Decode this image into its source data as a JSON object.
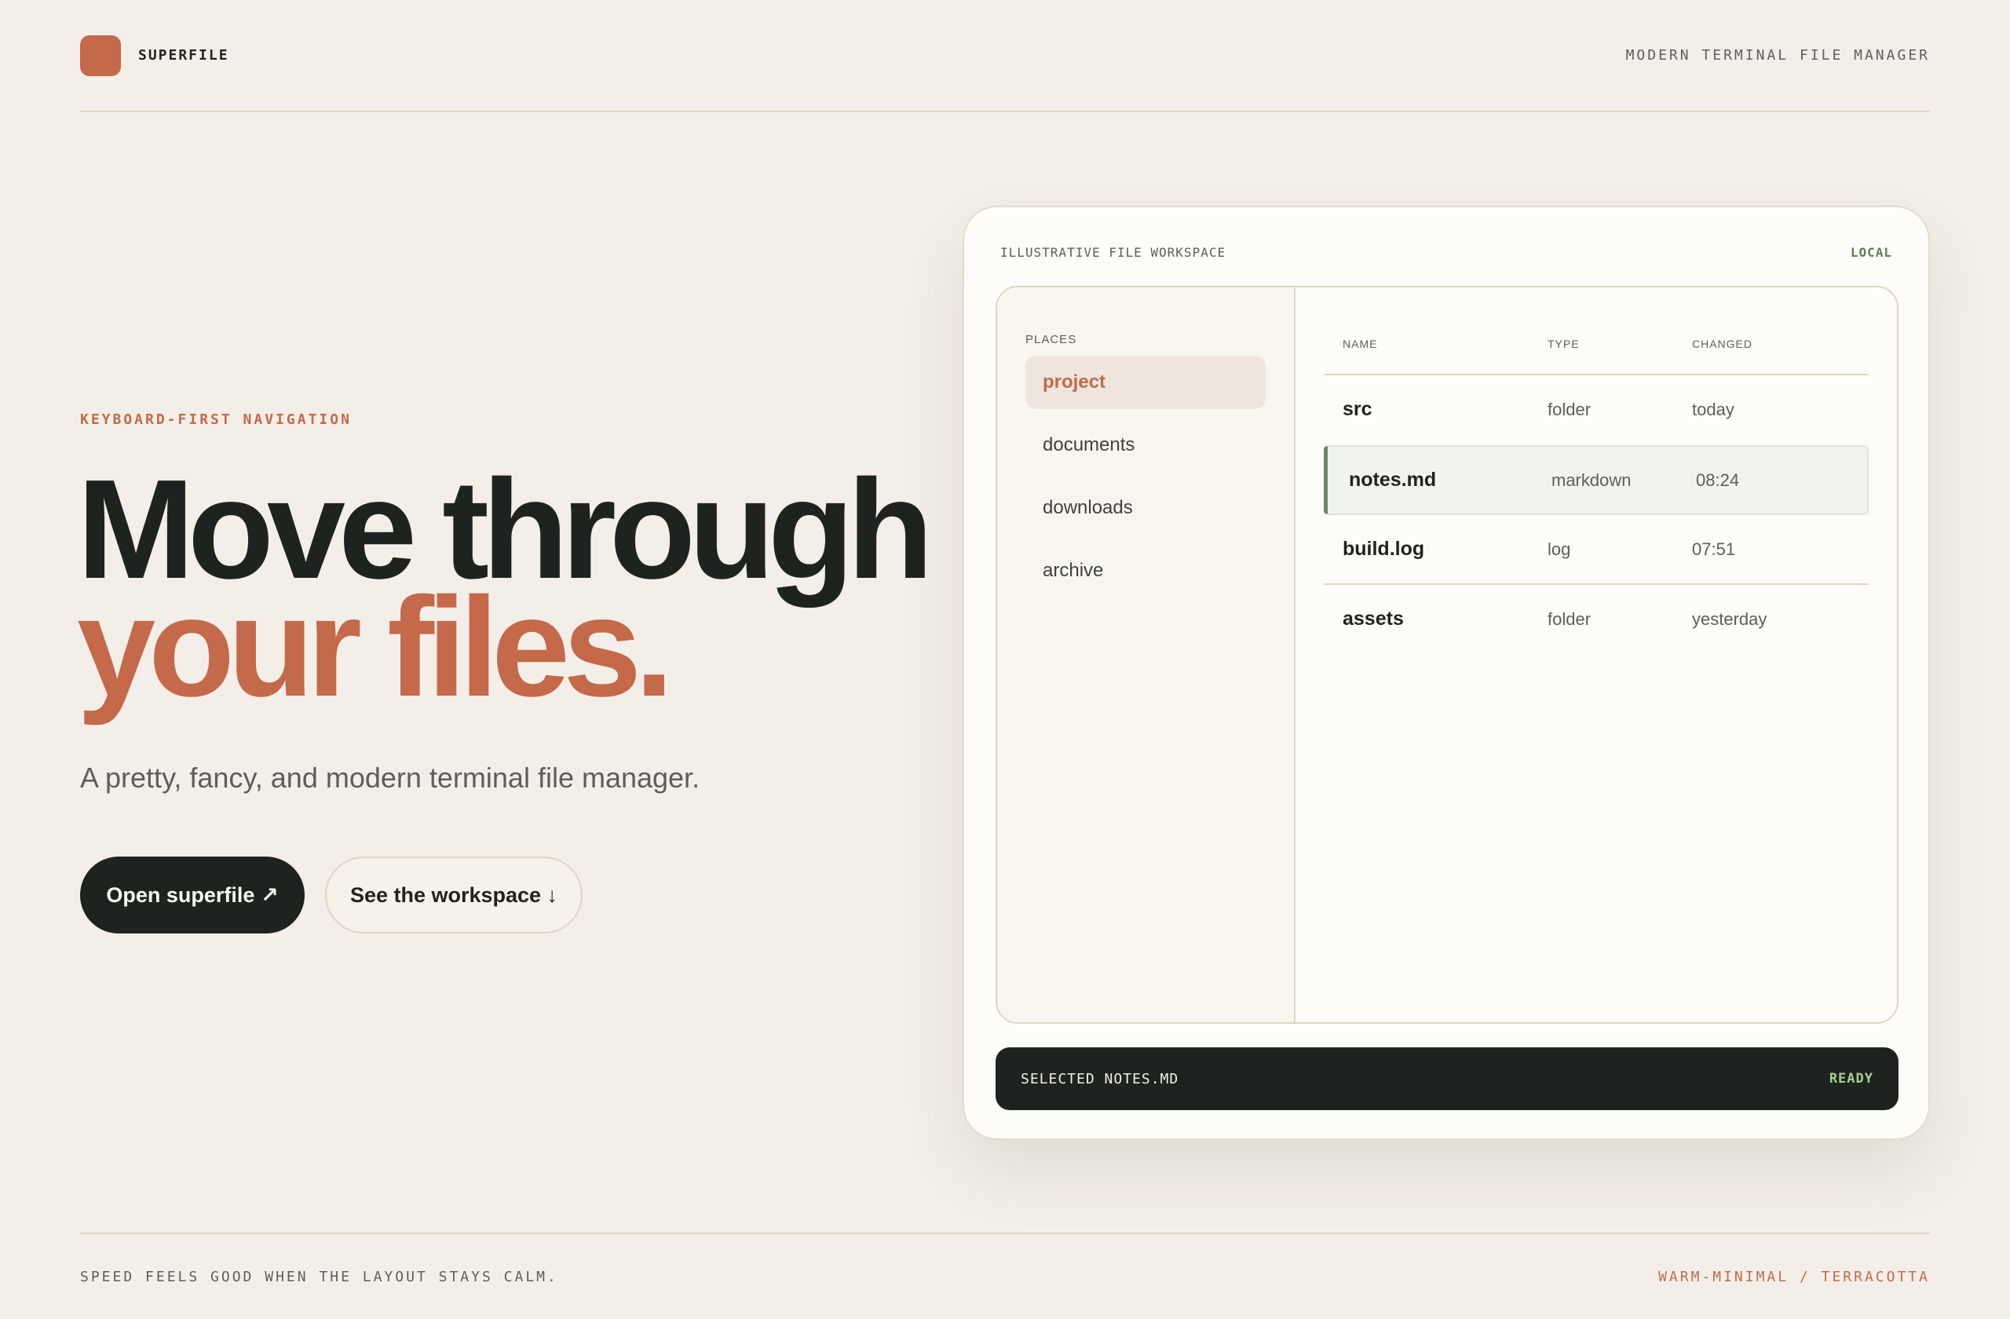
{
  "header": {
    "brand": "SUPERFILE",
    "tagline": "MODERN TERMINAL FILE MANAGER"
  },
  "hero": {
    "eyebrow": "KEYBOARD-FIRST NAVIGATION",
    "headline_line1": "Move through",
    "headline_line2": "your files.",
    "subtitle": "A pretty, fancy, and modern terminal file manager.",
    "primary_button": "Open superfile ↗",
    "secondary_button": "See the workspace ↓"
  },
  "workspace": {
    "title": "ILLUSTRATIVE FILE WORKSPACE",
    "mode": "LOCAL",
    "places_label": "PLACES",
    "places": [
      {
        "label": "project",
        "active": true
      },
      {
        "label": "documents",
        "active": false
      },
      {
        "label": "downloads",
        "active": false
      },
      {
        "label": "archive",
        "active": false
      }
    ],
    "columns": {
      "name": "NAME",
      "type": "TYPE",
      "changed": "CHANGED"
    },
    "files": [
      {
        "name": "src",
        "type": "folder",
        "changed": "today"
      },
      {
        "name": "notes.md",
        "type": "markdown",
        "changed": "08:24"
      },
      {
        "name": "build.log",
        "type": "log",
        "changed": "07:51"
      },
      {
        "name": "assets",
        "type": "folder",
        "changed": "yesterday"
      }
    ],
    "status": "SELECTED NOTES.MD",
    "status_state": "READY"
  },
  "footer": {
    "left": "SPEED FEELS GOOD WHEN THE LAYOUT STAYS CALM.",
    "right": "WARM-MINIMAL / TERRACOTTA"
  },
  "colors": {
    "accent": "#c4694a",
    "dark": "#1f231f",
    "background": "#f3efe8",
    "ready": "#a7cf8c",
    "selection_bar": "#6c8862"
  }
}
